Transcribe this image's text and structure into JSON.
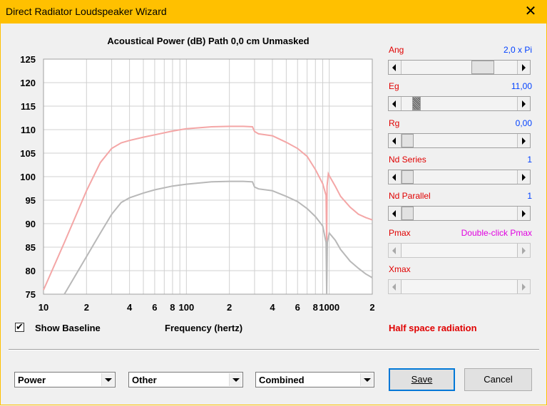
{
  "window": {
    "title": "Direct Radiator Loudspeaker Wizard",
    "close_glyph": "✕"
  },
  "chart_data": {
    "type": "line",
    "title": "Acoustical Power (dB)   Path 0,0 cm   Unmasked",
    "xlabel": "Frequency (hertz)",
    "ylabel": "",
    "x_scale": "log",
    "xlim": [
      10,
      2000
    ],
    "ylim": [
      75,
      125
    ],
    "y_ticks": [
      75,
      80,
      85,
      90,
      95,
      100,
      105,
      110,
      115,
      120,
      125
    ],
    "x_ticks": [
      {
        "value": 10,
        "label": "10"
      },
      {
        "value": 20,
        "label": "2"
      },
      {
        "value": 40,
        "label": "4"
      },
      {
        "value": 60,
        "label": "6"
      },
      {
        "value": 80,
        "label": "8"
      },
      {
        "value": 100,
        "label": "100"
      },
      {
        "value": 200,
        "label": "2"
      },
      {
        "value": 400,
        "label": "4"
      },
      {
        "value": 600,
        "label": "6"
      },
      {
        "value": 800,
        "label": "8"
      },
      {
        "value": 1000,
        "label": "1000"
      },
      {
        "value": 2000,
        "label": "2"
      }
    ],
    "grid": true,
    "series": [
      {
        "color": "#f4a6a6",
        "points": [
          [
            10,
            75.9
          ],
          [
            14,
            86
          ],
          [
            20,
            97
          ],
          [
            25,
            103
          ],
          [
            30,
            106
          ],
          [
            35,
            107.2
          ],
          [
            40,
            107.7
          ],
          [
            50,
            108.4
          ],
          [
            60,
            108.9
          ],
          [
            80,
            109.7
          ],
          [
            100,
            110.2
          ],
          [
            150,
            110.6
          ],
          [
            200,
            110.7
          ],
          [
            250,
            110.7
          ],
          [
            290,
            110.6
          ],
          [
            300,
            109.6
          ],
          [
            320,
            109.1
          ],
          [
            400,
            108.7
          ],
          [
            500,
            107.3
          ],
          [
            600,
            106
          ],
          [
            700,
            104.3
          ],
          [
            800,
            101.5
          ],
          [
            900,
            98.5
          ],
          [
            950,
            96
          ],
          [
            960,
            85
          ],
          [
            965,
            98
          ],
          [
            985,
            100.6
          ],
          [
            1000,
            100.2
          ],
          [
            1100,
            98
          ],
          [
            1200,
            95.8
          ],
          [
            1400,
            93.5
          ],
          [
            1600,
            92
          ],
          [
            1800,
            91.3
          ],
          [
            2000,
            90.8
          ]
        ]
      },
      {
        "color": "#b8b8b8",
        "points": [
          [
            14,
            75
          ],
          [
            20,
            83
          ],
          [
            25,
            88
          ],
          [
            30,
            92
          ],
          [
            35,
            94.5
          ],
          [
            40,
            95.5
          ],
          [
            50,
            96.5
          ],
          [
            60,
            97.2
          ],
          [
            80,
            98
          ],
          [
            100,
            98.4
          ],
          [
            150,
            98.9
          ],
          [
            200,
            99.0
          ],
          [
            250,
            99.0
          ],
          [
            290,
            98.9
          ],
          [
            300,
            97.8
          ],
          [
            320,
            97.4
          ],
          [
            400,
            97.0
          ],
          [
            500,
            95.8
          ],
          [
            600,
            94.7
          ],
          [
            700,
            93.2
          ],
          [
            800,
            91.5
          ],
          [
            900,
            89.5
          ],
          [
            950,
            86
          ],
          [
            960,
            75
          ],
          [
            970,
            86
          ],
          [
            1000,
            88
          ],
          [
            1100,
            86.5
          ],
          [
            1200,
            84.5
          ],
          [
            1400,
            82
          ],
          [
            1600,
            80.5
          ],
          [
            1800,
            79.3
          ],
          [
            2000,
            78.5
          ]
        ]
      }
    ]
  },
  "controls": [
    {
      "key": "ang",
      "label": "Ang",
      "value": "2,0 x Pi",
      "thumb": 0.75,
      "disabled": false
    },
    {
      "key": "eg",
      "label": "Eg",
      "value": "11,00",
      "thumb": 0.1,
      "disabled": false
    },
    {
      "key": "rg",
      "label": "Rg",
      "value": "0,00",
      "thumb": 0.0,
      "disabled": false
    },
    {
      "key": "nd_series",
      "label": "Nd  Series",
      "value": "1",
      "thumb": 0.0,
      "disabled": false
    },
    {
      "key": "nd_parallel",
      "label": "Nd  Parallel",
      "value": "1",
      "thumb": 0.0,
      "disabled": false
    },
    {
      "key": "pmax",
      "label": "Pmax",
      "value": "Double-click Pmax",
      "thumb": null,
      "disabled": true
    },
    {
      "key": "xmax",
      "label": "Xmax",
      "value": "",
      "thumb": null,
      "disabled": true
    }
  ],
  "colors": {
    "label_red": "#e00000",
    "value_blue": "#0040ff",
    "value_pink": "#e000e0",
    "title_bar": "#ffc000"
  },
  "show_baseline": {
    "label": "Show Baseline",
    "checked": true,
    "check_glyph": "✔"
  },
  "radiation_note": "Half space radiation",
  "selects": {
    "mode": "Power",
    "type": "Other",
    "combine": "Combined"
  },
  "buttons": {
    "save": "Save",
    "cancel": "Cancel"
  }
}
